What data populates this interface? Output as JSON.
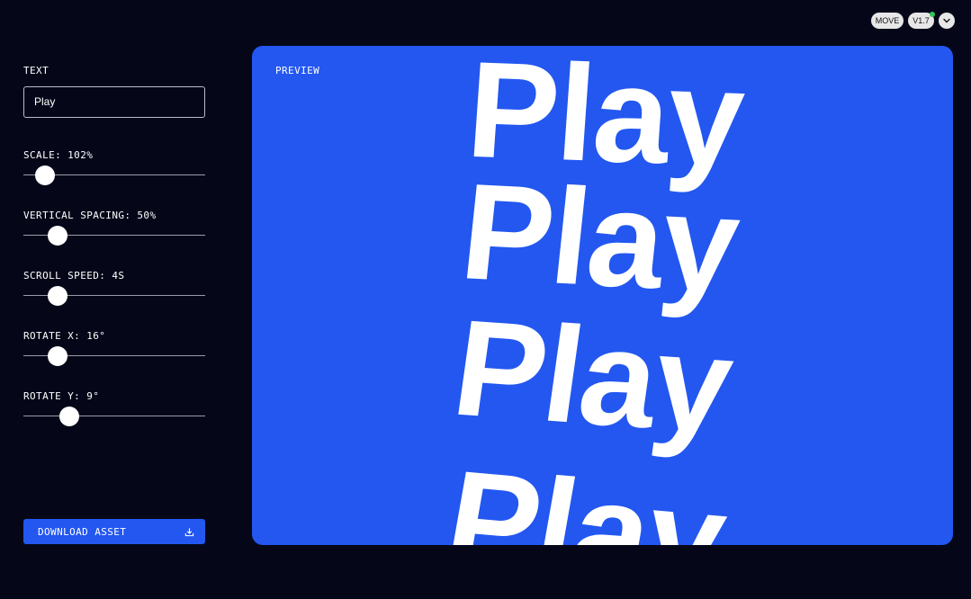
{
  "header": {
    "mode_label": "MOVE",
    "version_label": "V1.7",
    "status_color": "#34c759"
  },
  "sidebar": {
    "text_label": "TEXT",
    "text_value": "Play",
    "sliders": [
      {
        "label": "SCALE: 102%",
        "fraction": 0.12
      },
      {
        "label": "VERTICAL SPACING: 50%",
        "fraction": 0.19
      },
      {
        "label": "SCROLL SPEED: 4S",
        "fraction": 0.19
      },
      {
        "label": "ROTATE X: 16°",
        "fraction": 0.19
      },
      {
        "label": "ROTATE Y: 9°",
        "fraction": 0.25
      }
    ],
    "download_label": "DOWNLOAD ASSET"
  },
  "preview": {
    "label": "PREVIEW",
    "words": [
      "Play",
      "Play",
      "Play",
      "Play"
    ]
  },
  "colors": {
    "background": "#050719",
    "accent": "#2357f0"
  }
}
